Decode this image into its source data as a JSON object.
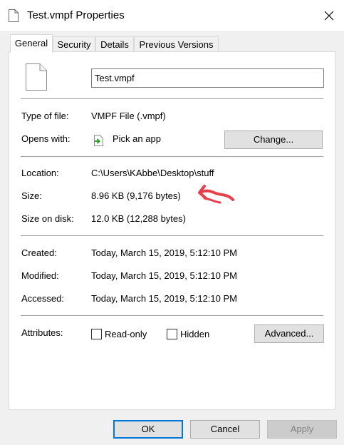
{
  "window": {
    "title": "Test.vmpf Properties",
    "close_icon": "close-icon"
  },
  "tabs": [
    {
      "label": "General",
      "active": true
    },
    {
      "label": "Security",
      "active": false
    },
    {
      "label": "Details",
      "active": false
    },
    {
      "label": "Previous Versions",
      "active": false
    }
  ],
  "general": {
    "file_name": "Test.vmpf",
    "type_label": "Type of file:",
    "type_value": "VMPF File (.vmpf)",
    "opens_label": "Opens with:",
    "opens_value": "Pick an app",
    "change_button": "Change...",
    "location_label": "Location:",
    "location_value": "C:\\Users\\KAbbe\\Desktop\\stuff",
    "size_label": "Size:",
    "size_value": "8.96 KB (9,176 bytes)",
    "size_on_disk_label": "Size on disk:",
    "size_on_disk_value": "12.0 KB (12,288 bytes)",
    "created_label": "Created:",
    "created_value": "Today, March 15, 2019, 5:12:10 PM",
    "modified_label": "Modified:",
    "modified_value": "Today, March 15, 2019, 5:12:10 PM",
    "accessed_label": "Accessed:",
    "accessed_value": "Today, March 15, 2019, 5:12:10 PM",
    "attributes_label": "Attributes:",
    "readonly_label": "Read-only",
    "readonly_checked": false,
    "hidden_label": "Hidden",
    "hidden_checked": false,
    "advanced_button": "Advanced..."
  },
  "footer": {
    "ok": "OK",
    "cancel": "Cancel",
    "apply": "Apply"
  },
  "colors": {
    "accent": "#0078d7",
    "annotation": "#e8404a"
  }
}
